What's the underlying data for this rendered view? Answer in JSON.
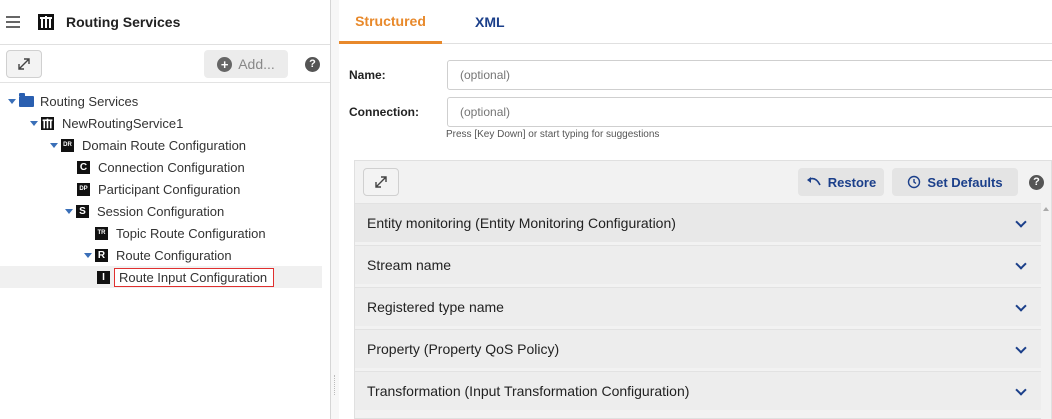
{
  "app": {
    "title": "Routing Services",
    "add_label": "Add...",
    "help_symbol": "?"
  },
  "tree": [
    {
      "label": "Routing Services",
      "icon": "folder-open-icon",
      "expanded": true
    },
    {
      "label": "NewRoutingService1",
      "icon": "routing-service-icon",
      "expanded": true
    },
    {
      "label": "Domain Route Configuration",
      "badge": "DR",
      "expanded": true
    },
    {
      "label": "Connection Configuration",
      "badge": "C"
    },
    {
      "label": "Participant Configuration",
      "badge": "DP"
    },
    {
      "label": "Session Configuration",
      "badge": "S",
      "expanded": true
    },
    {
      "label": "Topic Route Configuration",
      "badge": "TR"
    },
    {
      "label": "Route Configuration",
      "badge": "R",
      "expanded": true
    },
    {
      "label": "Route Input Configuration",
      "badge": "I",
      "selected": true
    }
  ],
  "tabs": [
    {
      "label": "Structured",
      "active": true
    },
    {
      "label": "XML",
      "active": false
    }
  ],
  "form": {
    "name_label": "Name:",
    "name_placeholder": "(optional)",
    "connection_label": "Connection:",
    "connection_placeholder": "(optional)",
    "connection_hint": "Press [Key Down] or start typing for suggestions"
  },
  "props_toolbar": {
    "restore_label": "Restore",
    "defaults_label": "Set Defaults"
  },
  "sections": [
    "Entity monitoring (Entity Monitoring Configuration)",
    "Stream name",
    "Registered type name",
    "Property (Property QoS Policy)",
    "Transformation (Input Transformation Configuration)"
  ],
  "colors": {
    "accent": "#e8892b",
    "link": "#1b3f8a",
    "selection_border": "#e0302f"
  }
}
